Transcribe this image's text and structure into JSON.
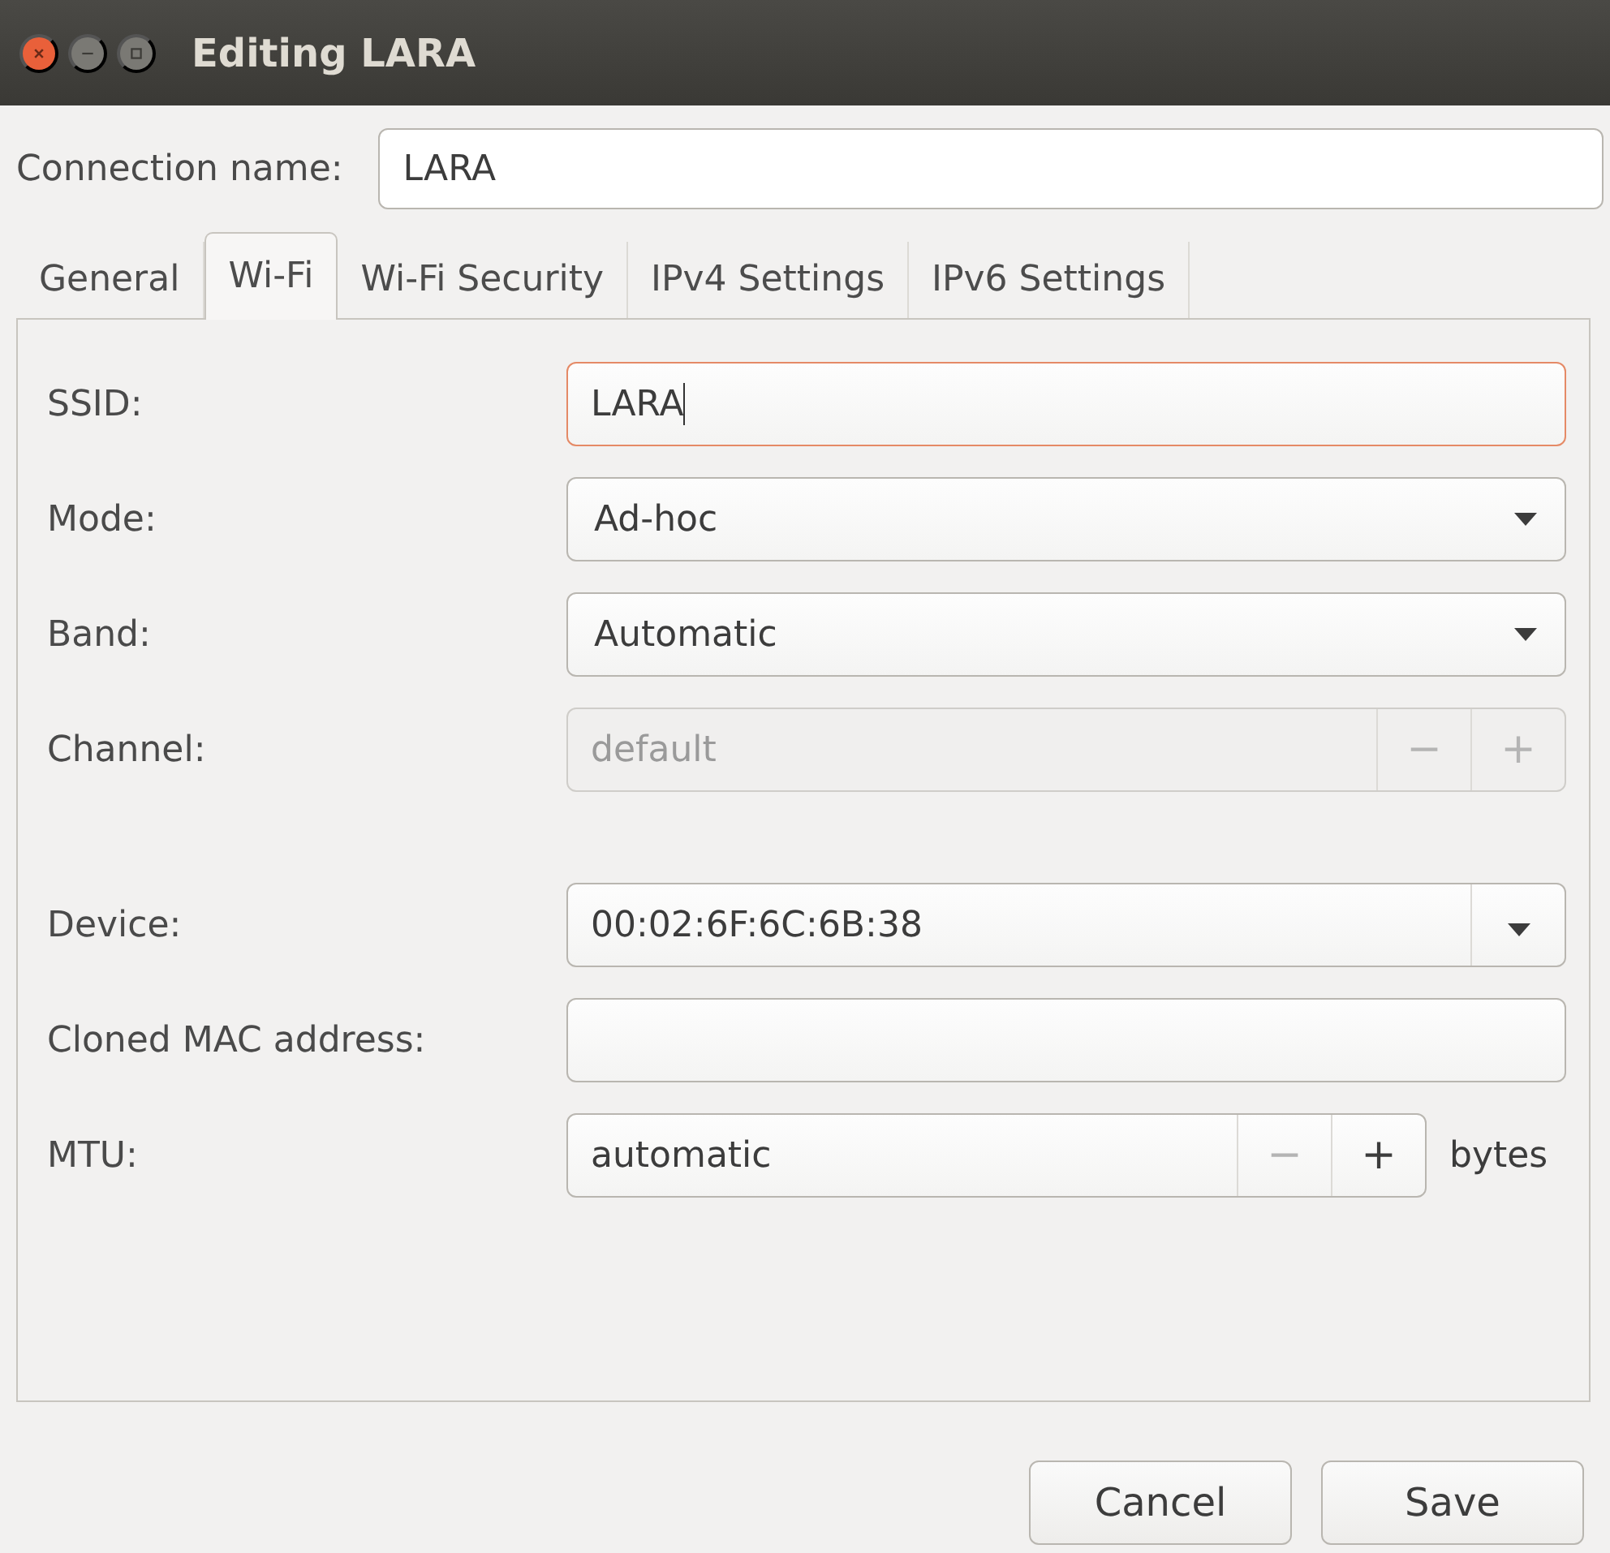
{
  "window": {
    "title": "Editing LARA"
  },
  "connection_name": {
    "label": "Connection name:",
    "value": "LARA"
  },
  "tabs": [
    {
      "label": "General",
      "selected": false
    },
    {
      "label": "Wi-Fi",
      "selected": true
    },
    {
      "label": "Wi-Fi Security",
      "selected": false
    },
    {
      "label": "IPv4 Settings",
      "selected": false
    },
    {
      "label": "IPv6 Settings",
      "selected": false
    }
  ],
  "field_groups": [
    [
      {
        "kind": "entry",
        "label": "SSID:",
        "value": "LARA",
        "focused": true,
        "disabled": false
      },
      {
        "kind": "combo",
        "label": "Mode:",
        "value": "Ad-hoc",
        "disabled": false
      },
      {
        "kind": "combo",
        "label": "Band:",
        "value": "Automatic",
        "disabled": false
      },
      {
        "kind": "spin",
        "label": "Channel:",
        "value": "default",
        "disabled": true,
        "decrement": "−",
        "increment": "+"
      }
    ],
    [
      {
        "kind": "combo_entry",
        "label": "Device:",
        "value": "00:02:6F:6C:6B:38",
        "disabled": false
      },
      {
        "kind": "entry",
        "label": "Cloned MAC address:",
        "focused": false,
        "disabled": false
      },
      {
        "kind": "spin",
        "label": "MTU:",
        "value": "automatic",
        "disabled": false,
        "decrement_disabled": true,
        "decrement": "−",
        "increment": "+",
        "unit": "bytes"
      }
    ]
  ],
  "buttons": [
    {
      "label": "Cancel"
    },
    {
      "label": "Save"
    }
  ]
}
